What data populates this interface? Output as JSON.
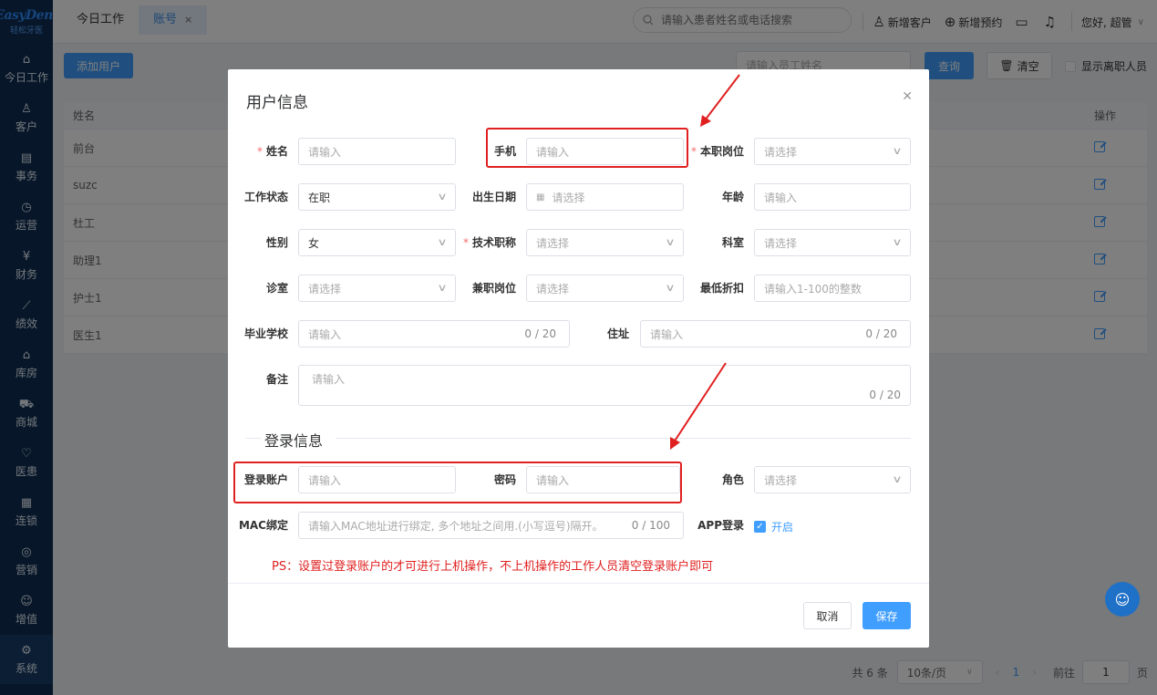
{
  "logo": {
    "main": "EasyDent",
    "sub": "轻松牙医"
  },
  "sidebar": {
    "items": [
      {
        "icon": "⌂",
        "label": "今日工作"
      },
      {
        "icon": "♙",
        "label": "客户"
      },
      {
        "icon": "▤",
        "label": "事务"
      },
      {
        "icon": "◷",
        "label": "运营"
      },
      {
        "icon": "¥",
        "label": "财务"
      },
      {
        "icon": "⟋",
        "label": "绩效"
      },
      {
        "icon": "⌂",
        "label": "库房"
      },
      {
        "icon": "⛟",
        "label": "商城"
      },
      {
        "icon": "♡",
        "label": "医患"
      },
      {
        "icon": "▦",
        "label": "连锁"
      },
      {
        "icon": "◎",
        "label": "营销"
      },
      {
        "icon": "☺",
        "label": "增值"
      },
      {
        "icon": "⚙",
        "label": "系统"
      }
    ]
  },
  "tabs": [
    {
      "label": "今日工作"
    },
    {
      "label": "账号",
      "close": "×"
    }
  ],
  "header": {
    "search_placeholder": "请输入患者姓名或电话搜索",
    "new_customer": "新增客户",
    "new_appointment": "新增预约",
    "greeting": "您好, 超管"
  },
  "toolbar": {
    "add_user": "添加用户",
    "staff_name_placeholder": "请输入员工姓名",
    "query": "查询",
    "clear": "清空",
    "show_resigned": "显示离职人员"
  },
  "table": {
    "col_name": "姓名",
    "col_op": "操作",
    "rows": [
      "前台",
      "suzc",
      "杜工",
      "助理1",
      "护士1",
      "医生1"
    ]
  },
  "pagination": {
    "total": "共 6 条",
    "page_size": "10条/页",
    "current": "1",
    "goto": "前往",
    "goto_value": "1",
    "page_unit": "页"
  },
  "dialog": {
    "title": "用户信息",
    "name_label": "姓名",
    "name_placeholder": "请输入",
    "phone_label": "手机",
    "phone_placeholder": "请输入",
    "position_label": "本职岗位",
    "position_placeholder": "请选择",
    "status_label": "工作状态",
    "status_value": "在职",
    "birth_label": "出生日期",
    "birth_placeholder": "请选择",
    "age_label": "年龄",
    "age_placeholder": "请输入",
    "gender_label": "性别",
    "gender_value": "女",
    "title_label": "技术职称",
    "title_placeholder": "请选择",
    "dept_label": "科室",
    "dept_placeholder": "请选择",
    "room_label": "诊室",
    "room_placeholder": "请选择",
    "parttime_label": "兼职岗位",
    "parttime_placeholder": "请选择",
    "discount_label": "最低折扣",
    "discount_placeholder": "请输入1-100的整数",
    "school_label": "毕业学校",
    "school_placeholder": "请输入",
    "school_count": "0 / 20",
    "address_label": "住址",
    "address_placeholder": "请输入",
    "address_count": "0 / 20",
    "remark_label": "备注",
    "remark_placeholder": "请输入",
    "remark_count": "0 / 20",
    "login_section": "登录信息",
    "account_label": "登录账户",
    "account_placeholder": "请输入",
    "password_label": "密码",
    "password_placeholder": "请输入",
    "role_label": "角色",
    "role_placeholder": "请选择",
    "mac_label": "MAC绑定",
    "mac_placeholder": "请输入MAC地址进行绑定, 多个地址之间用.(小写逗号)隔开。",
    "mac_count": "0 / 100",
    "app_label": "APP登录",
    "app_value": "开启",
    "ps": "PS：设置过登录账户的才可进行上机操作，不上机操作的工作人员清空登录账户即可",
    "cancel": "取消",
    "save": "保存"
  },
  "colors": {
    "accent": "#409eff",
    "sidebar": "#0f2f52",
    "highlight": "#e02020"
  }
}
